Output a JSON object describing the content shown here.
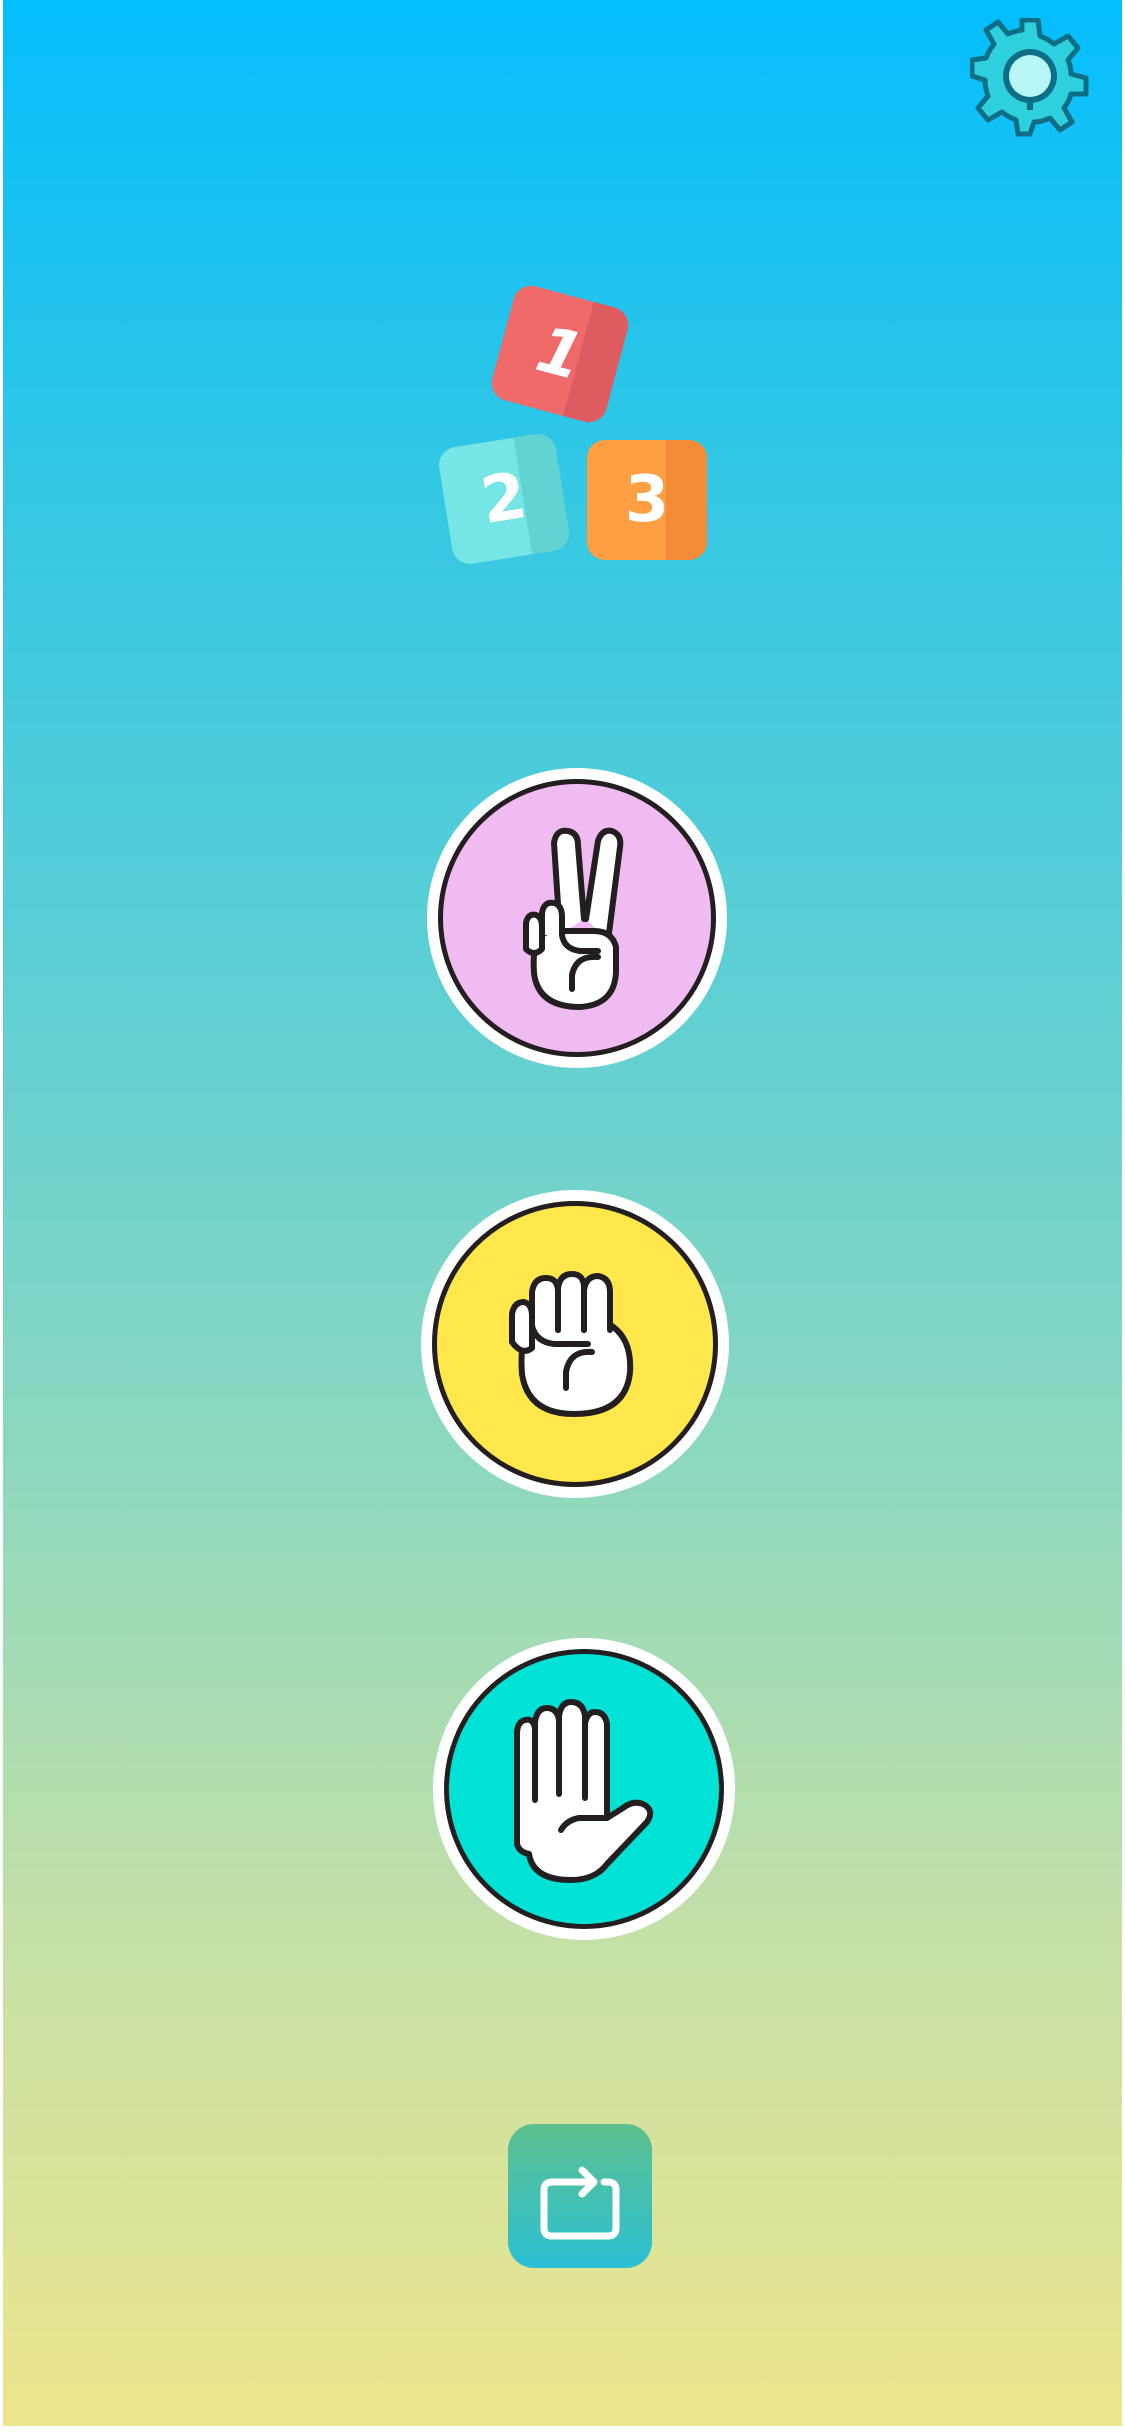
{
  "app": {
    "logo": {
      "tiles": [
        "1",
        "2",
        "3"
      ]
    }
  },
  "icons": {
    "settings": "gear-icon",
    "scissors": "peace-hand-icon",
    "rock": "fist-icon",
    "paper": "open-hand-icon",
    "restart": "repeat-icon"
  },
  "colors": {
    "scissors_button": "#EFBBF0",
    "rock_button": "#FFE74C",
    "paper_button": "#00E2D6",
    "tile_1": "#F06A6A",
    "tile_2": "#76E5E5",
    "tile_3": "#FF9E42",
    "gear": "#2FD0DD",
    "background_top": "#04BEFD",
    "background_bottom": "#EDE68D"
  }
}
